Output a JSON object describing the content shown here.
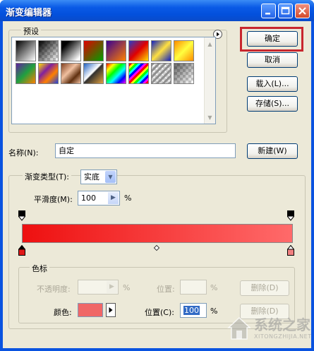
{
  "window": {
    "title": "渐变编辑器"
  },
  "presets": {
    "label": "预设",
    "swatch_names": [
      "foreground-to-background",
      "foreground-to-transparent",
      "black-white",
      "red-green",
      "violet-orange",
      "blue-red-yellow",
      "blue-yellow-blue",
      "orange-yellow-orange",
      "violet-green-orange",
      "yellow-violet-orange-blue",
      "copper",
      "chrome",
      "spectrum",
      "transparent-rainbow",
      "transparent-stripes",
      "neutral-density"
    ]
  },
  "buttons": {
    "ok": "确定",
    "cancel": "取消",
    "load": "载入(L)...",
    "save": "存储(S)...",
    "new": "新建(W)",
    "delete_opacity": "删除(D)",
    "delete_color": "删除(D)"
  },
  "name_field": {
    "label": "名称(N):",
    "value": "自定"
  },
  "gradient_type": {
    "label": "渐变类型(T):",
    "value": "实底"
  },
  "smoothness": {
    "label": "平滑度(M):",
    "value": "100",
    "unit": "%"
  },
  "stops": {
    "group_label": "色标",
    "opacity_label": "不透明度:",
    "opacity_unit": "%",
    "opacity_location_label": "位置:",
    "opacity_location_unit": "%",
    "color_label": "颜色:",
    "color_value": "#f06767",
    "location_label": "位置(C):",
    "location_value": "100",
    "location_unit": "%"
  },
  "gradient": {
    "start_color": "#ee1010",
    "end_color": "#ff6a6a"
  },
  "watermark": {
    "text": "系统之家",
    "url": "XITONGZHIJIA.NET"
  },
  "colors": {
    "title_blue": "#0a53e0",
    "dialog_bg": "#ece9d8",
    "highlight_red": "#c8262e"
  },
  "icons": {
    "minimize": "minimize-icon",
    "maximize": "maximize-icon",
    "close": "close-icon"
  }
}
